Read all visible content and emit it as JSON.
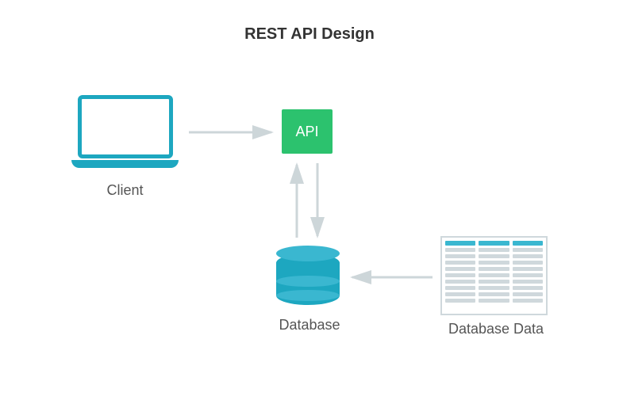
{
  "title": "REST API Design",
  "nodes": {
    "client": {
      "label": "Client"
    },
    "api": {
      "label": "API"
    },
    "database": {
      "label": "Database"
    },
    "data": {
      "label": "Database Data"
    }
  },
  "colors": {
    "accent_teal": "#1da7c0",
    "accent_green": "#2cc26e",
    "arrow": "#cdd6d9",
    "data_row": "#cfd8dc"
  },
  "edges": [
    {
      "from": "client",
      "to": "api",
      "direction": "right"
    },
    {
      "from": "api",
      "to": "database",
      "direction": "bidirectional"
    },
    {
      "from": "data",
      "to": "database",
      "direction": "left"
    }
  ]
}
